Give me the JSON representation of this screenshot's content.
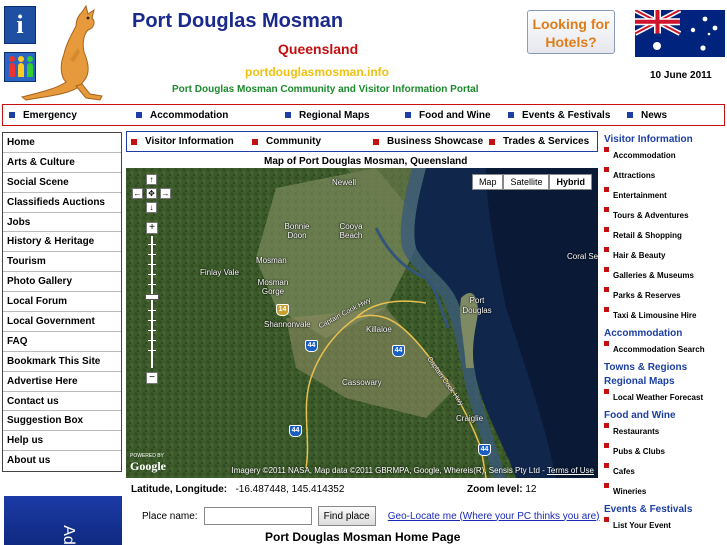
{
  "header": {
    "info_icon": "info-icon",
    "people_icon": "people-icon",
    "logo": "kangaroo-logo",
    "title": "Port Douglas Mosman",
    "subtitle": "Queensland",
    "url": "portdouglasmosman.info",
    "portal_text": "Port Douglas Mosman Community and Visitor Information Portal",
    "hotels_line1": "Looking for",
    "hotels_line2": "Hotels?",
    "flag": "australia-flag",
    "date": "10 June 2011"
  },
  "main_nav": [
    "Emergency",
    "Accommodation",
    "Regional Maps",
    "Food and Wine",
    "Events & Festivals",
    "News"
  ],
  "sub_nav": [
    "Visitor Information",
    "Community",
    "Business Showcase",
    "Trades & Services"
  ],
  "left_nav": [
    "Home",
    "Arts & Culture",
    "Social Scene",
    "Classifieds Auctions",
    "Jobs",
    "History & Heritage",
    "Tourism",
    "Photo Gallery",
    "Local Forum",
    "Local Government",
    "FAQ",
    "Bookmark This Site",
    "Advertise Here",
    "Contact us",
    "Suggestion Box",
    "Help us",
    "About us"
  ],
  "ad_banner_text": "Ad",
  "map": {
    "title": "Map of Port Douglas Mosman, Queensland",
    "types": [
      "Map",
      "Satellite",
      "Hybrid"
    ],
    "selected_type": "Hybrid",
    "labels": {
      "newell": "Newell",
      "bonnie_doon": "Bonnie Doon",
      "cooya_beach": "Cooya Beach",
      "finlay_vale": "Finlay Vale",
      "mosman": "Mosman",
      "mosman_gorge": "Mosman Gorge",
      "shannonvale": "Shannonvale",
      "killaloe": "Killaloe",
      "port_douglas": "Port Douglas",
      "coral_sea": "Coral Se",
      "cassowary": "Cassowary",
      "craiglie": "Craiglie",
      "captain_cook_hwy": "Captain Cook Hwy",
      "captain_cook_hwy_2": "Captain Cook Hwy"
    },
    "shields": [
      "14",
      "44",
      "44",
      "44",
      "44"
    ],
    "powered_by": "POWERED BY",
    "google": "Google",
    "copyright": "Imagery ©2011 NASA, Map data ©2011 GBRMPA, Google, Whereis(R), Sensis Pty Ltd - ",
    "terms": "Terms of Use"
  },
  "coords": {
    "label": "Latitude, Longitude:",
    "value": "-16.487448, 145.414352",
    "zoom_label": "Zoom level:",
    "zoom_value": "12"
  },
  "place": {
    "label": "Place name:",
    "value": "",
    "find": "Find place",
    "geo": "Geo-Locate me (Where your PC thinks you are)"
  },
  "home_heading": "Port Douglas Mosman Home Page",
  "right_nav": [
    {
      "type": "heading",
      "text": "Visitor Information"
    },
    {
      "type": "item",
      "text": "Accommodation"
    },
    {
      "type": "item",
      "text": "Attractions"
    },
    {
      "type": "item",
      "text": "Entertainment"
    },
    {
      "type": "item",
      "text": "Tours & Adventures"
    },
    {
      "type": "item",
      "text": "Retail & Shopping"
    },
    {
      "type": "item",
      "text": "Hair & Beauty"
    },
    {
      "type": "item",
      "text": "Galleries & Museums"
    },
    {
      "type": "item",
      "text": "Parks & Reserves"
    },
    {
      "type": "item",
      "text": "Taxi & Limousine Hire"
    },
    {
      "type": "heading",
      "text": "Accommodation"
    },
    {
      "type": "item",
      "text": "Accommodation Search"
    },
    {
      "type": "heading",
      "text": "Towns & Regions"
    },
    {
      "type": "heading",
      "text": "Regional Maps"
    },
    {
      "type": "item",
      "text": "Local Weather Forecast"
    },
    {
      "type": "heading",
      "text": "Food and Wine"
    },
    {
      "type": "item",
      "text": "Restaurants"
    },
    {
      "type": "item",
      "text": "Pubs & Clubs"
    },
    {
      "type": "item",
      "text": "Cafes"
    },
    {
      "type": "item",
      "text": "Wineries"
    },
    {
      "type": "heading",
      "text": "Events & Festivals"
    },
    {
      "type": "item",
      "text": "List Your Event"
    }
  ],
  "colors": {
    "title_blue": "#1a2a8c",
    "subtitle_red": "#c41010",
    "url_yellow": "#f2c010",
    "portal_green": "#1b8a2c",
    "hotels_orange": "#e07c1a",
    "nav_blue": "#1d3fa3"
  }
}
